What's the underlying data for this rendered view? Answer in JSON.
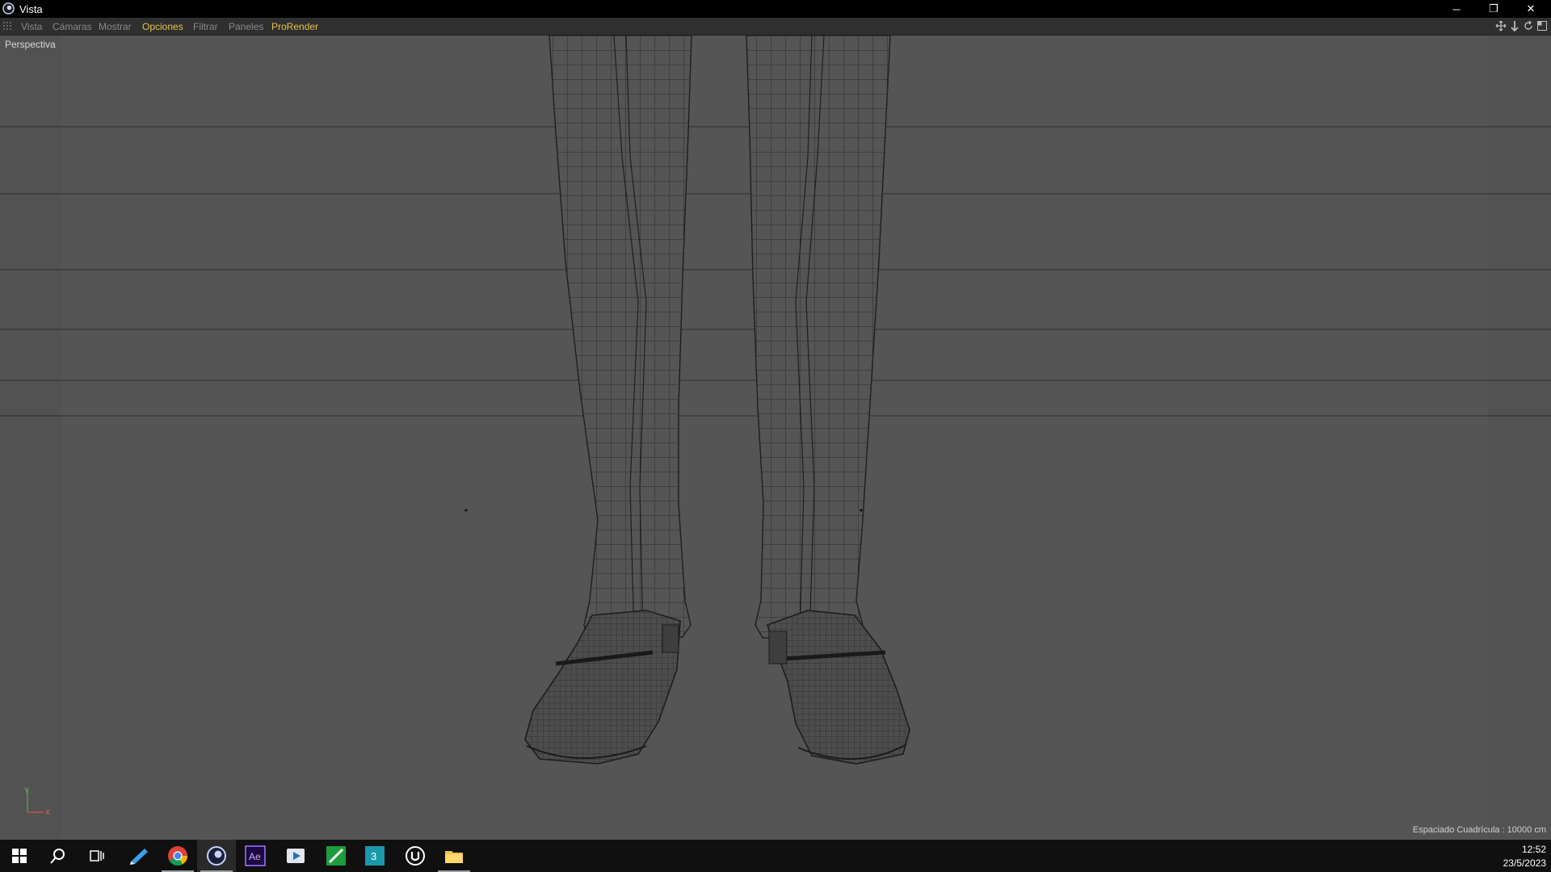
{
  "window": {
    "title": "Vista",
    "icon": "cinema4d-logo-icon"
  },
  "controls": {
    "minimize": "─",
    "restore": "❐",
    "close": "✕"
  },
  "menu": {
    "items": [
      {
        "label": "Vista",
        "active": false
      },
      {
        "label": "Cámaras",
        "active": false
      },
      {
        "label": "Mostrar",
        "active": false
      },
      {
        "label": "Opciones",
        "active": true
      },
      {
        "label": "Filtrar",
        "active": false
      },
      {
        "label": "Paneles",
        "active": false
      },
      {
        "label": "ProRender",
        "active": true
      }
    ],
    "tools": [
      "move-view-icon",
      "dolly-view-icon",
      "rotate-view-icon",
      "toggle-panel-icon"
    ]
  },
  "viewport": {
    "label": "Perspectiva",
    "grid_spacing": "Espaciado Cuadrícula : 10000 cm",
    "axis": {
      "y": "Y",
      "x": "X"
    }
  },
  "taskbar": {
    "apps": [
      "start-icon",
      "search-icon",
      "task-view-icon",
      "pen-app-icon",
      "chrome-icon",
      "cinema4d-icon",
      "after-effects-icon",
      "media-player-icon",
      "green-app-icon",
      "3dsmax-icon",
      "unreal-engine-icon",
      "file-explorer-icon"
    ],
    "ae_label": "Ae",
    "max_label": "3",
    "time": "12:52",
    "date": "23/5/2023"
  },
  "colors": {
    "accent_menu": "#e8c24a",
    "viewport_bg": "#555555",
    "wire": "#222222"
  }
}
